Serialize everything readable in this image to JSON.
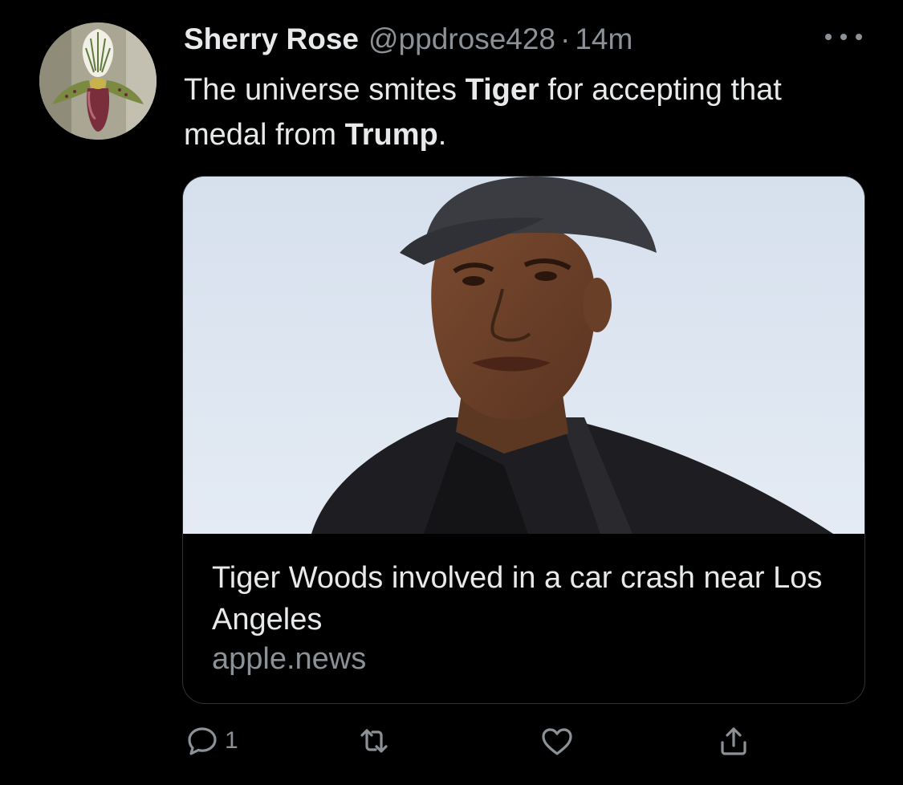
{
  "tweet": {
    "author_name": "Sherry Rose",
    "handle": "@ppdrose428",
    "separator": "·",
    "timestamp": "14m",
    "text_parts": {
      "p1": "The universe smites ",
      "p2": "Tiger",
      "p3": " for accepting that medal from ",
      "p4": "Trump",
      "p5": "."
    },
    "more_icon": "more-dots-icon",
    "avatar_description": "orchid-avatar"
  },
  "card": {
    "title": "Tiger Woods involved in a car crash near Los Angeles",
    "domain": "apple.news"
  },
  "actions": {
    "reply_icon": "reply-icon",
    "reply_count": "1",
    "retweet_icon": "retweet-icon",
    "like_icon": "heart-icon",
    "share_icon": "share-icon"
  },
  "colors": {
    "background": "#000000",
    "text": "#e7e9ea",
    "secondary": "#8b9196",
    "border": "#2f3336"
  }
}
